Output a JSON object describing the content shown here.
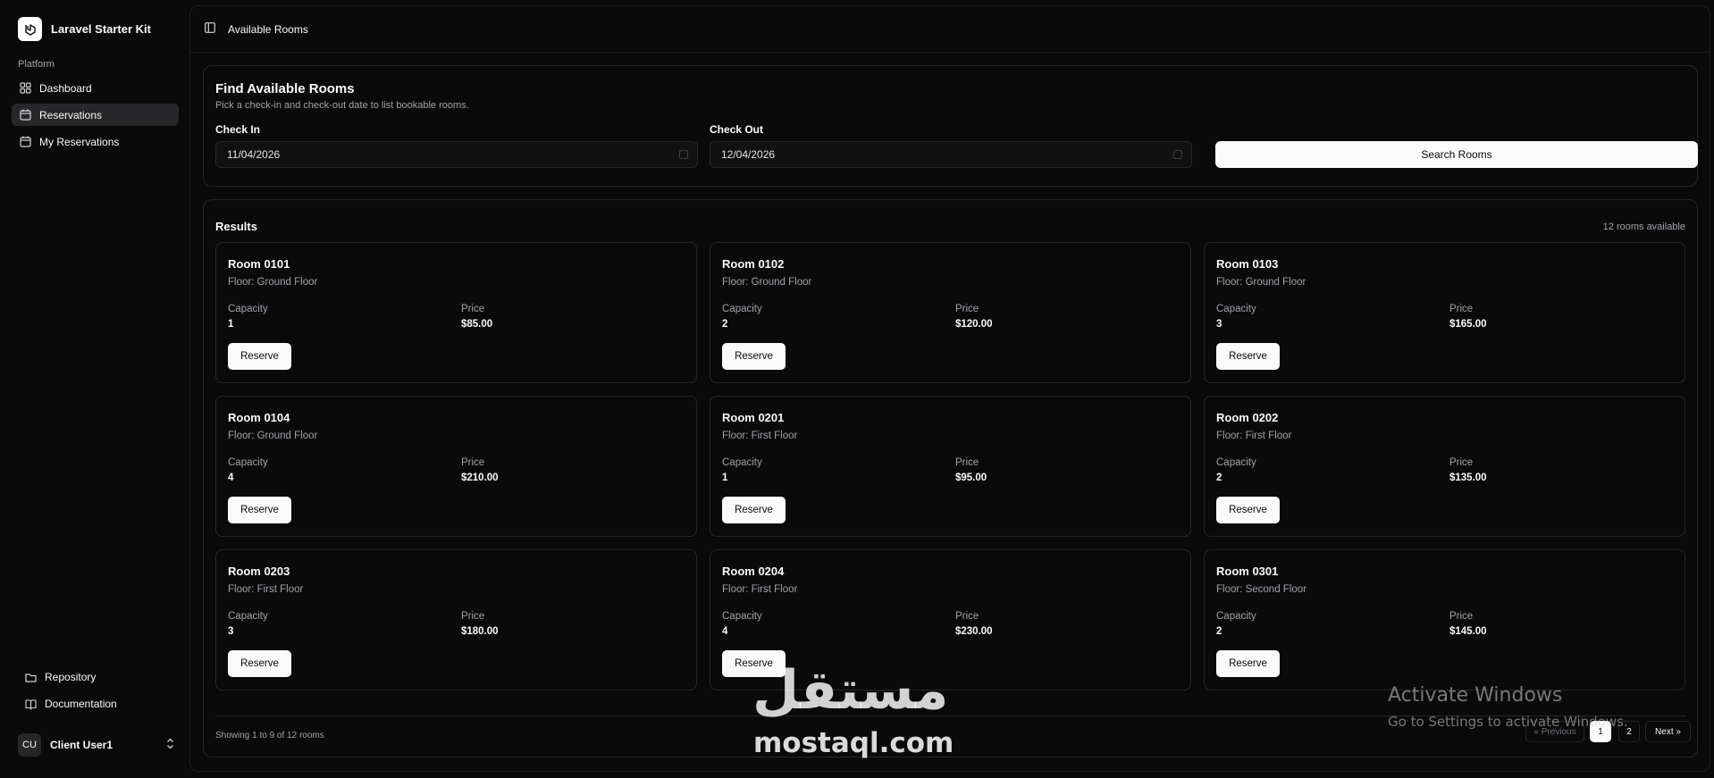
{
  "sidebar": {
    "brand": "Laravel Starter Kit",
    "section_heading": "Platform",
    "items": [
      {
        "label": "Dashboard",
        "icon": "grid-icon"
      },
      {
        "label": "Reservations",
        "icon": "calendar-icon",
        "active": true
      },
      {
        "label": "My Reservations",
        "icon": "calendar-icon"
      }
    ],
    "footer_links": [
      {
        "label": "Repository",
        "icon": "folder-icon"
      },
      {
        "label": "Documentation",
        "icon": "book-icon"
      }
    ],
    "user": {
      "initials": "CU",
      "name": "Client User1"
    }
  },
  "header": {
    "title": "Available Rooms"
  },
  "search": {
    "title": "Find Available Rooms",
    "subtitle": "Pick a check-in and check-out date to list bookable rooms.",
    "check_in_label": "Check In",
    "check_in_value": "11/04/2026",
    "check_out_label": "Check Out",
    "check_out_value": "12/04/2026",
    "button_label": "Search Rooms"
  },
  "results": {
    "title": "Results",
    "count_text": "12 rooms available",
    "capacity_label": "Capacity",
    "price_label": "Price",
    "reserve_label": "Reserve",
    "rooms": [
      {
        "name": "Room 0101",
        "floor": "Floor: Ground Floor",
        "capacity": "1",
        "price": "$85.00"
      },
      {
        "name": "Room 0102",
        "floor": "Floor: Ground Floor",
        "capacity": "2",
        "price": "$120.00"
      },
      {
        "name": "Room 0103",
        "floor": "Floor: Ground Floor",
        "capacity": "3",
        "price": "$165.00"
      },
      {
        "name": "Room 0104",
        "floor": "Floor: Ground Floor",
        "capacity": "4",
        "price": "$210.00"
      },
      {
        "name": "Room 0201",
        "floor": "Floor: First Floor",
        "capacity": "1",
        "price": "$95.00"
      },
      {
        "name": "Room 0202",
        "floor": "Floor: First Floor",
        "capacity": "2",
        "price": "$135.00"
      },
      {
        "name": "Room 0203",
        "floor": "Floor: First Floor",
        "capacity": "3",
        "price": "$180.00"
      },
      {
        "name": "Room 0204",
        "floor": "Floor: First Floor",
        "capacity": "4",
        "price": "$230.00"
      },
      {
        "name": "Room 0301",
        "floor": "Floor: Second Floor",
        "capacity": "2",
        "price": "$145.00"
      }
    ],
    "showing_text": "Showing 1 to 9 of 12 rooms",
    "pagination": {
      "previous": "« Previous",
      "pages": [
        "1",
        "2"
      ],
      "current": "1",
      "next": "Next »"
    }
  },
  "overlay": {
    "watermark_arabic": "مستقل",
    "watermark_latin": "mostaql.com",
    "activate_title": "Activate Windows",
    "activate_sub": "Go to Settings to activate Windows."
  }
}
